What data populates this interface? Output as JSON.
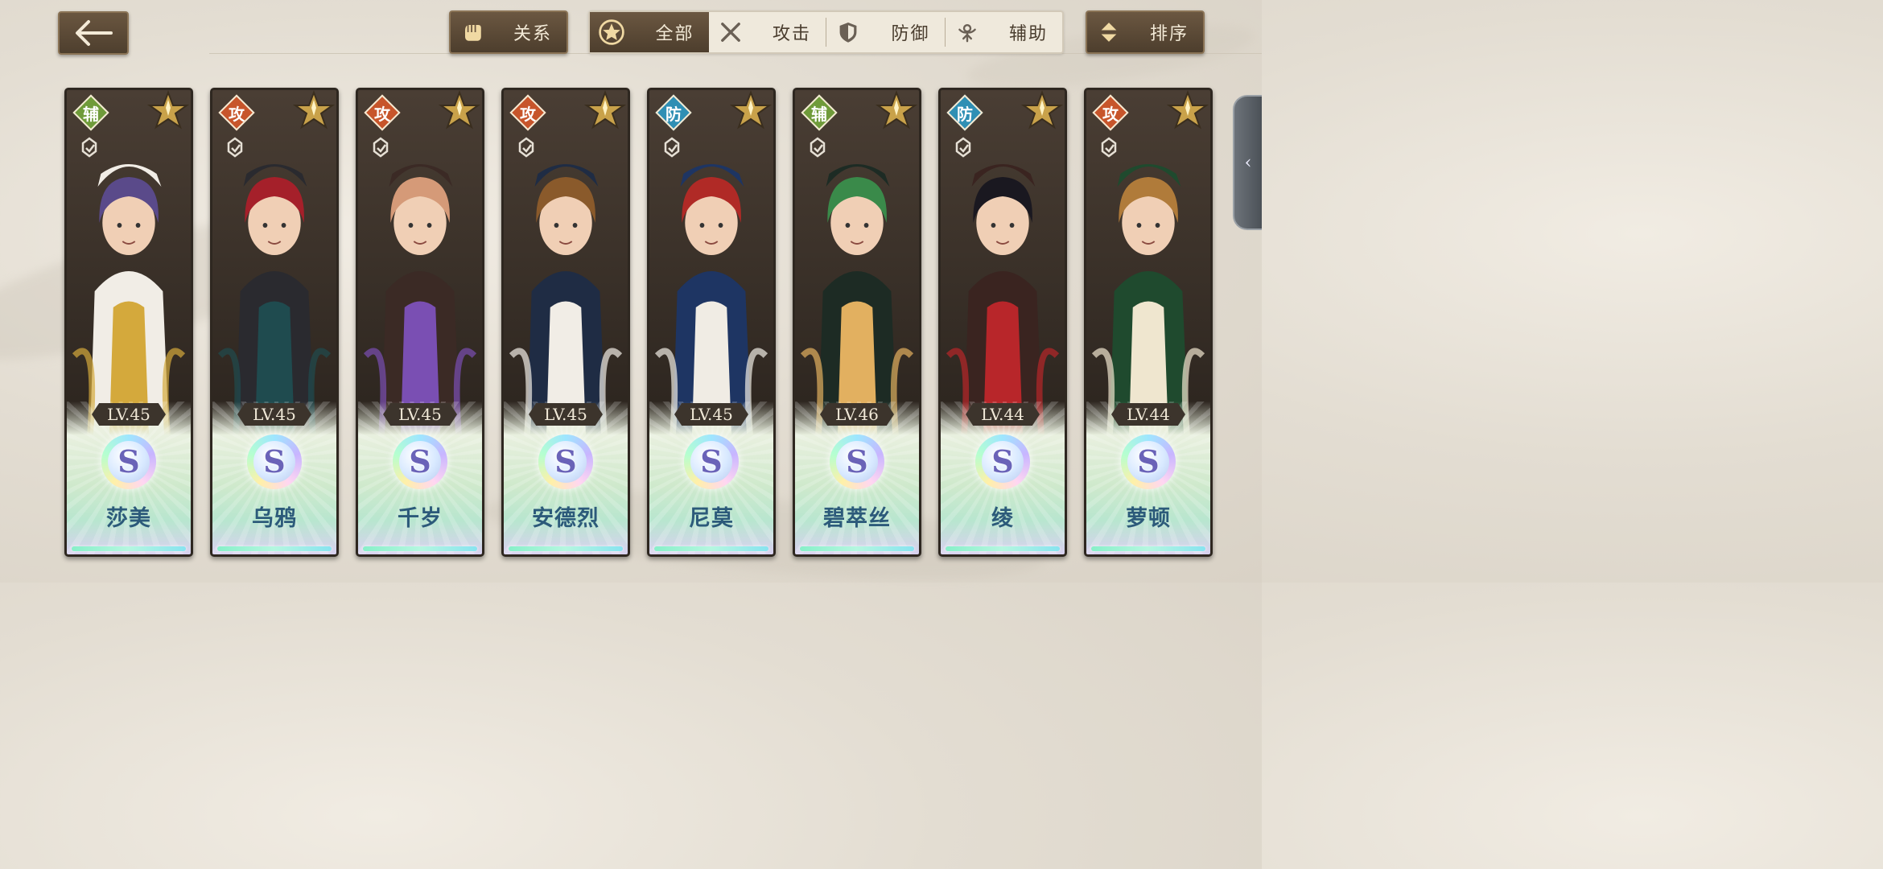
{
  "top_bar": {
    "back": {
      "icon": "back-arrow-icon"
    },
    "relation": {
      "label": "关系",
      "icon": "fist-icon"
    },
    "filters": [
      {
        "label": "全部",
        "icon": "star-emblem-icon",
        "active": true
      },
      {
        "label": "攻击",
        "icon": "crossed-swords-icon",
        "active": false
      },
      {
        "label": "防御",
        "icon": "shield-icon",
        "active": false
      },
      {
        "label": "辅助",
        "icon": "support-icon",
        "active": false
      }
    ],
    "sort": {
      "label": "排序",
      "icon": "sort-arrows-icon"
    }
  },
  "characters": [
    {
      "name": "莎美",
      "level": "LV.45",
      "role": "辅",
      "role_type": "assist",
      "rank": "S",
      "palette": [
        "#f1ede6",
        "#d4a93c",
        "#5a4a8a"
      ]
    },
    {
      "name": "乌鸦",
      "level": "LV.45",
      "role": "攻",
      "role_type": "attack",
      "rank": "S",
      "palette": [
        "#2a2a2f",
        "#1f4b4f",
        "#a5202a"
      ]
    },
    {
      "name": "千岁",
      "level": "LV.45",
      "role": "攻",
      "role_type": "attack",
      "rank": "S",
      "palette": [
        "#3b2a25",
        "#7a4fb3",
        "#d59a78"
      ]
    },
    {
      "name": "安德烈",
      "level": "LV.45",
      "role": "攻",
      "role_type": "attack",
      "rank": "S",
      "palette": [
        "#1f2c44",
        "#f1ede6",
        "#8a5a2b"
      ]
    },
    {
      "name": "尼莫",
      "level": "LV.45",
      "role": "防",
      "role_type": "defense",
      "rank": "S",
      "palette": [
        "#1e3563",
        "#f0ece4",
        "#b02a26"
      ]
    },
    {
      "name": "碧萃丝",
      "level": "LV.46",
      "role": "辅",
      "role_type": "assist",
      "rank": "S",
      "palette": [
        "#1d2b24",
        "#e2b060",
        "#3a8a4a"
      ]
    },
    {
      "name": "绫",
      "level": "LV.44",
      "role": "防",
      "role_type": "defense",
      "rank": "S",
      "palette": [
        "#3a2420",
        "#b8262a",
        "#1a1820"
      ]
    },
    {
      "name": "萝顿",
      "level": "LV.44",
      "role": "攻",
      "role_type": "attack",
      "rank": "S",
      "palette": [
        "#1f4a2e",
        "#efe6cf",
        "#b07b3a"
      ]
    }
  ],
  "side_panel": {
    "icon": "chevron-left-icon"
  }
}
